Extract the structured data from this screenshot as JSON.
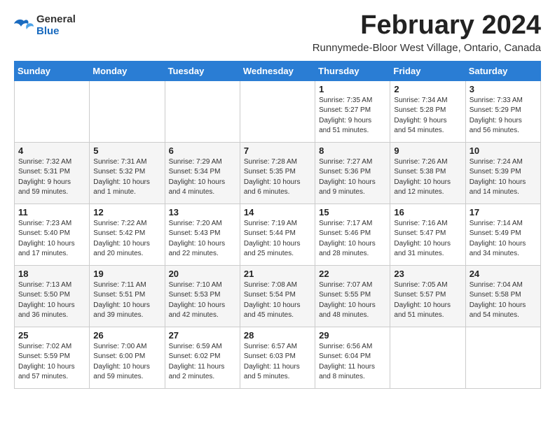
{
  "logo": {
    "general": "General",
    "blue": "Blue"
  },
  "header": {
    "title": "February 2024",
    "subtitle": "Runnymede-Bloor West Village, Ontario, Canada"
  },
  "weekdays": [
    "Sunday",
    "Monday",
    "Tuesday",
    "Wednesday",
    "Thursday",
    "Friday",
    "Saturday"
  ],
  "weeks": [
    [
      {
        "day": "",
        "info": ""
      },
      {
        "day": "",
        "info": ""
      },
      {
        "day": "",
        "info": ""
      },
      {
        "day": "",
        "info": ""
      },
      {
        "day": "1",
        "info": "Sunrise: 7:35 AM\nSunset: 5:27 PM\nDaylight: 9 hours\nand 51 minutes."
      },
      {
        "day": "2",
        "info": "Sunrise: 7:34 AM\nSunset: 5:28 PM\nDaylight: 9 hours\nand 54 minutes."
      },
      {
        "day": "3",
        "info": "Sunrise: 7:33 AM\nSunset: 5:29 PM\nDaylight: 9 hours\nand 56 minutes."
      }
    ],
    [
      {
        "day": "4",
        "info": "Sunrise: 7:32 AM\nSunset: 5:31 PM\nDaylight: 9 hours\nand 59 minutes."
      },
      {
        "day": "5",
        "info": "Sunrise: 7:31 AM\nSunset: 5:32 PM\nDaylight: 10 hours\nand 1 minute."
      },
      {
        "day": "6",
        "info": "Sunrise: 7:29 AM\nSunset: 5:34 PM\nDaylight: 10 hours\nand 4 minutes."
      },
      {
        "day": "7",
        "info": "Sunrise: 7:28 AM\nSunset: 5:35 PM\nDaylight: 10 hours\nand 6 minutes."
      },
      {
        "day": "8",
        "info": "Sunrise: 7:27 AM\nSunset: 5:36 PM\nDaylight: 10 hours\nand 9 minutes."
      },
      {
        "day": "9",
        "info": "Sunrise: 7:26 AM\nSunset: 5:38 PM\nDaylight: 10 hours\nand 12 minutes."
      },
      {
        "day": "10",
        "info": "Sunrise: 7:24 AM\nSunset: 5:39 PM\nDaylight: 10 hours\nand 14 minutes."
      }
    ],
    [
      {
        "day": "11",
        "info": "Sunrise: 7:23 AM\nSunset: 5:40 PM\nDaylight: 10 hours\nand 17 minutes."
      },
      {
        "day": "12",
        "info": "Sunrise: 7:22 AM\nSunset: 5:42 PM\nDaylight: 10 hours\nand 20 minutes."
      },
      {
        "day": "13",
        "info": "Sunrise: 7:20 AM\nSunset: 5:43 PM\nDaylight: 10 hours\nand 22 minutes."
      },
      {
        "day": "14",
        "info": "Sunrise: 7:19 AM\nSunset: 5:44 PM\nDaylight: 10 hours\nand 25 minutes."
      },
      {
        "day": "15",
        "info": "Sunrise: 7:17 AM\nSunset: 5:46 PM\nDaylight: 10 hours\nand 28 minutes."
      },
      {
        "day": "16",
        "info": "Sunrise: 7:16 AM\nSunset: 5:47 PM\nDaylight: 10 hours\nand 31 minutes."
      },
      {
        "day": "17",
        "info": "Sunrise: 7:14 AM\nSunset: 5:49 PM\nDaylight: 10 hours\nand 34 minutes."
      }
    ],
    [
      {
        "day": "18",
        "info": "Sunrise: 7:13 AM\nSunset: 5:50 PM\nDaylight: 10 hours\nand 36 minutes."
      },
      {
        "day": "19",
        "info": "Sunrise: 7:11 AM\nSunset: 5:51 PM\nDaylight: 10 hours\nand 39 minutes."
      },
      {
        "day": "20",
        "info": "Sunrise: 7:10 AM\nSunset: 5:53 PM\nDaylight: 10 hours\nand 42 minutes."
      },
      {
        "day": "21",
        "info": "Sunrise: 7:08 AM\nSunset: 5:54 PM\nDaylight: 10 hours\nand 45 minutes."
      },
      {
        "day": "22",
        "info": "Sunrise: 7:07 AM\nSunset: 5:55 PM\nDaylight: 10 hours\nand 48 minutes."
      },
      {
        "day": "23",
        "info": "Sunrise: 7:05 AM\nSunset: 5:57 PM\nDaylight: 10 hours\nand 51 minutes."
      },
      {
        "day": "24",
        "info": "Sunrise: 7:04 AM\nSunset: 5:58 PM\nDaylight: 10 hours\nand 54 minutes."
      }
    ],
    [
      {
        "day": "25",
        "info": "Sunrise: 7:02 AM\nSunset: 5:59 PM\nDaylight: 10 hours\nand 57 minutes."
      },
      {
        "day": "26",
        "info": "Sunrise: 7:00 AM\nSunset: 6:00 PM\nDaylight: 10 hours\nand 59 minutes."
      },
      {
        "day": "27",
        "info": "Sunrise: 6:59 AM\nSunset: 6:02 PM\nDaylight: 11 hours\nand 2 minutes."
      },
      {
        "day": "28",
        "info": "Sunrise: 6:57 AM\nSunset: 6:03 PM\nDaylight: 11 hours\nand 5 minutes."
      },
      {
        "day": "29",
        "info": "Sunrise: 6:56 AM\nSunset: 6:04 PM\nDaylight: 11 hours\nand 8 minutes."
      },
      {
        "day": "",
        "info": ""
      },
      {
        "day": "",
        "info": ""
      }
    ]
  ]
}
